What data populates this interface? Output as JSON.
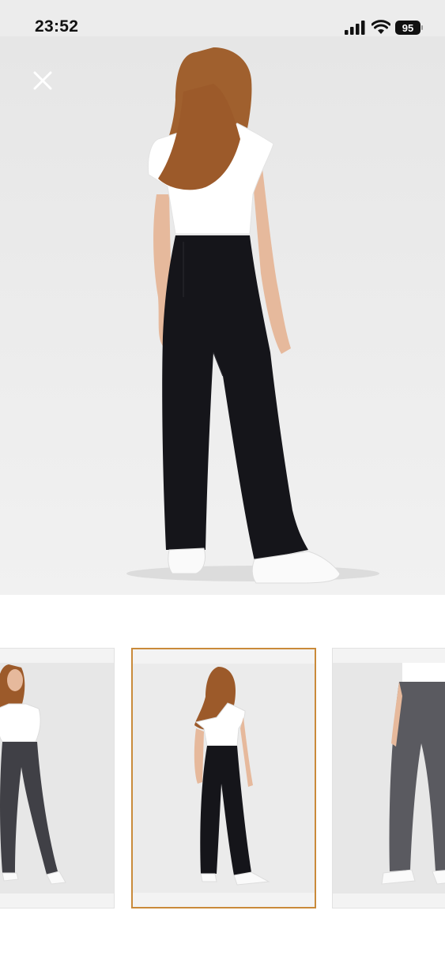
{
  "status": {
    "time": "23:52",
    "battery": "95",
    "icons": [
      "signal-icon",
      "wifi-icon",
      "battery-icon"
    ]
  },
  "viewer": {
    "close_icon": "close-icon",
    "main_image": "model-back-view-black-trousers",
    "thumbnails": [
      {
        "name": "model-front-view",
        "selected": false
      },
      {
        "name": "model-back-view",
        "selected": true
      },
      {
        "name": "trousers-close-up",
        "selected": false
      }
    ],
    "accent_color": "#c98a3a"
  }
}
